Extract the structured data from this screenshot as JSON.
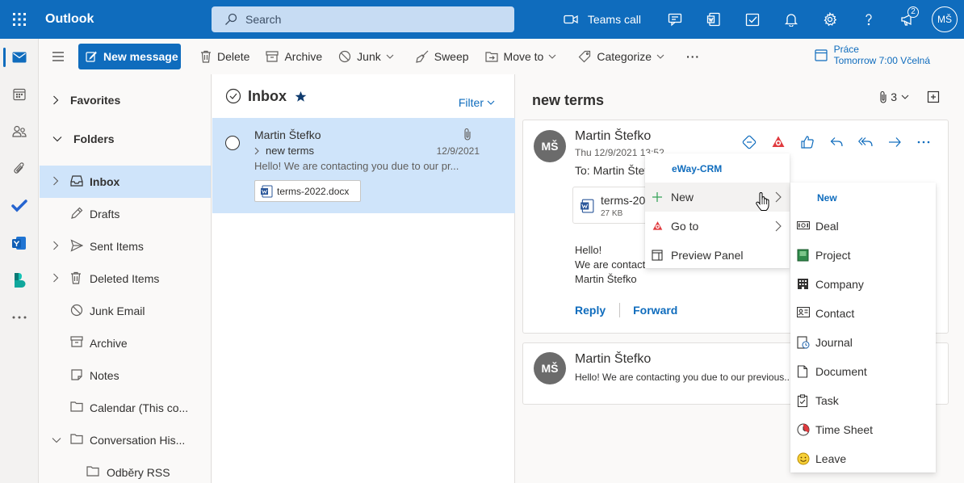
{
  "app": {
    "brand": "Outlook"
  },
  "search": {
    "placeholder": "Search"
  },
  "topbar": {
    "teams_label": "Teams call",
    "notification_count": "2",
    "user_initials": "MŠ"
  },
  "commands": {
    "new_message": "New message",
    "delete": "Delete",
    "archive": "Archive",
    "junk": "Junk",
    "sweep": "Sweep",
    "move_to": "Move to",
    "categorize": "Categorize",
    "more": "···"
  },
  "calendar_reminder": {
    "title": "Práce",
    "time": "Tomorrow 7:00 Včelná"
  },
  "folders": {
    "favorites": "Favorites",
    "folders": "Folders",
    "items": [
      {
        "label": "Inbox"
      },
      {
        "label": "Drafts"
      },
      {
        "label": "Sent Items"
      },
      {
        "label": "Deleted Items"
      },
      {
        "label": "Junk Email"
      },
      {
        "label": "Archive"
      },
      {
        "label": "Notes"
      },
      {
        "label": "Calendar (This co..."
      },
      {
        "label": "Conversation His..."
      },
      {
        "label": "Odběry RSS"
      }
    ]
  },
  "message_list": {
    "title": "Inbox",
    "filter": "Filter",
    "items": [
      {
        "sender": "Martin Štefko",
        "subject": "new terms",
        "date": "12/9/2021",
        "preview": "Hello! We are contacting you due to our pr...",
        "attachment": "terms-2022.docx"
      }
    ]
  },
  "reading": {
    "subject": "new terms",
    "attachment_count": "3",
    "message1": {
      "initials": "MŠ",
      "sender": "Martin Štefko",
      "date": "Thu 12/9/2021 13:52",
      "to": "To: Martin Štefko",
      "attachment_name": "terms-20",
      "attachment_size": "27 KB",
      "body_line1": "Hello!",
      "body_line2": "We are contact",
      "body_line3": "Martin Štefko",
      "reply": "Reply",
      "forward": "Forward"
    },
    "message2": {
      "initials": "MŠ",
      "sender": "Martin Štefko",
      "preview": "Hello! We are contacting you due to our previous..."
    }
  },
  "eway_menu": {
    "header": "eWay-CRM",
    "items": [
      {
        "label": "New"
      },
      {
        "label": "Go to"
      },
      {
        "label": "Preview Panel"
      }
    ]
  },
  "new_submenu": {
    "header": "New",
    "items": [
      {
        "label": "Deal"
      },
      {
        "label": "Project"
      },
      {
        "label": "Company"
      },
      {
        "label": "Contact"
      },
      {
        "label": "Journal"
      },
      {
        "label": "Document"
      },
      {
        "label": "Task"
      },
      {
        "label": "Time Sheet"
      },
      {
        "label": "Leave"
      }
    ]
  },
  "colors": {
    "accent": "#0f6cbd",
    "selected": "#cfe4fa",
    "search_bg": "#c7dcf3"
  }
}
